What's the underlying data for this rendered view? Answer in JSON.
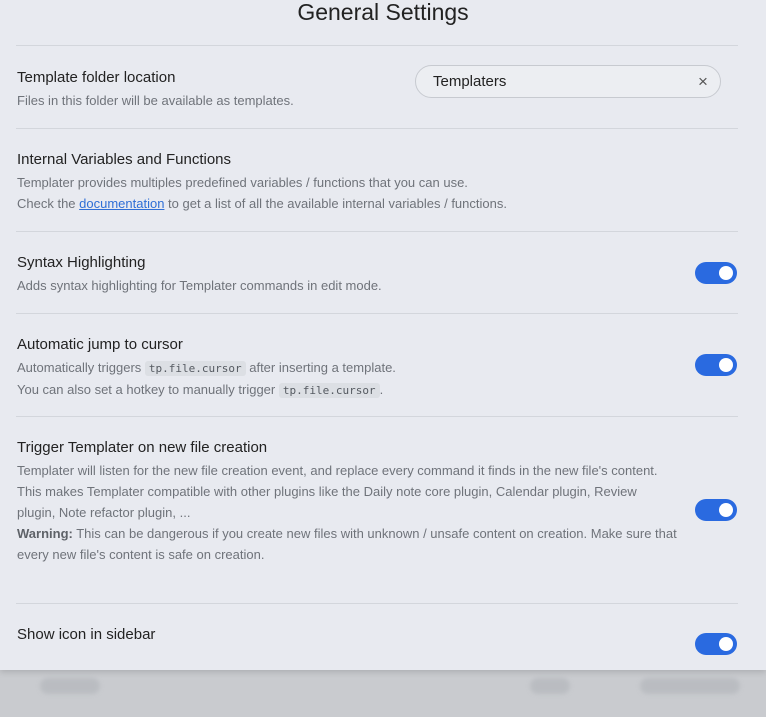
{
  "header": {
    "title": "General Settings"
  },
  "settings": [
    {
      "name": "Template folder location",
      "desc": "Files in this folder will be available as templates.",
      "input_value": "Templaters",
      "clear_label": "×"
    },
    {
      "name": "Internal Variables and Functions",
      "desc_line1": "Templater provides multiples predefined variables / functions that you can use.",
      "desc_line2_pre": "Check the ",
      "desc_link": "documentation",
      "desc_line2_post": " to get a list of all the available internal variables / functions."
    },
    {
      "name": "Syntax Highlighting",
      "desc": "Adds syntax highlighting for Templater commands in edit mode.",
      "enabled": true
    },
    {
      "name": "Automatic jump to cursor",
      "desc_line1_pre": "Automatically triggers ",
      "desc_code": "tp.file.cursor",
      "desc_line1_post": " after inserting a template.",
      "desc_line2_pre": "You can also set a hotkey to manually trigger ",
      "desc_line2_post": ".",
      "enabled": true
    },
    {
      "name": "Trigger Templater on new file creation",
      "desc_p1": "Templater will listen for the new file creation event, and replace every command it finds in the new file's content.",
      "desc_p2": "This makes Templater compatible with other plugins like the Daily note core plugin, Calendar plugin, Review plugin, Note refactor plugin, ...",
      "warning_label": "Warning:",
      "warning_text": " This can be dangerous if you create new files with unknown / unsafe content on creation. Make sure that every new file's content is safe on creation.",
      "enabled": true
    },
    {
      "name": "Show icon in sidebar",
      "enabled": true
    }
  ],
  "colors": {
    "accent": "#2a6ae0",
    "link": "#2f6fd6"
  }
}
